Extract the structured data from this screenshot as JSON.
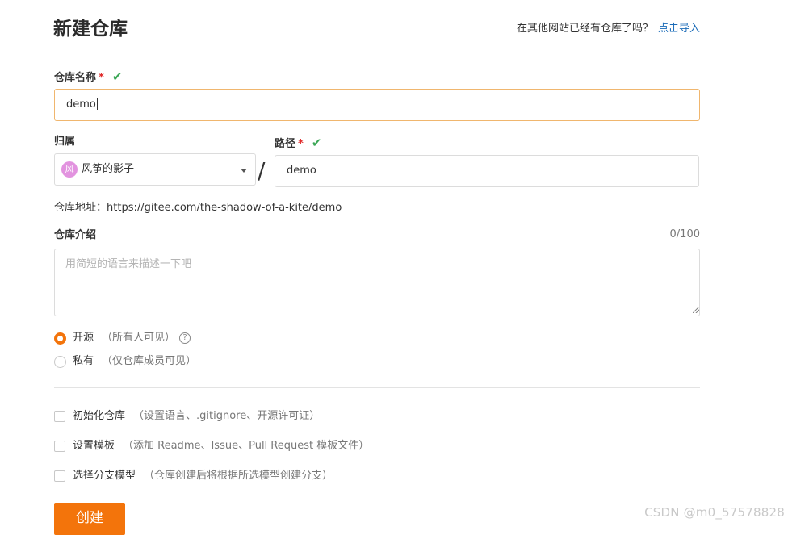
{
  "header": {
    "title": "新建仓库",
    "import_prompt": "在其他网站已经有仓库了吗？",
    "import_link": "点击导入"
  },
  "repo_name": {
    "label": "仓库名称",
    "required_mark": "*",
    "valid_icon": "check-icon",
    "value": "demo"
  },
  "owner": {
    "label": "归属",
    "avatar_char": "风",
    "value": "风筝的影子"
  },
  "separator": "/",
  "path": {
    "label": "路径",
    "required_mark": "*",
    "valid_icon": "check-icon",
    "value": "demo"
  },
  "address": {
    "label": "仓库地址：",
    "url": "https://gitee.com/the-shadow-of-a-kite/demo"
  },
  "intro": {
    "label": "仓库介绍",
    "counter": "0/100",
    "placeholder": "用简短的语言来描述一下吧"
  },
  "visibility": {
    "options": [
      {
        "label": "开源",
        "hint": "（所有人可见）",
        "selected": true,
        "help": "?"
      },
      {
        "label": "私有",
        "hint": "（仅仓库成员可见）",
        "selected": false
      }
    ]
  },
  "init_options": [
    {
      "label": "初始化仓库",
      "hint": "（设置语言、.gitignore、开源许可证）",
      "checked": false
    },
    {
      "label": "设置模板",
      "hint": "（添加 Readme、Issue、Pull Request 模板文件）",
      "checked": false
    },
    {
      "label": "选择分支模型",
      "hint": "（仓库创建后将根据所选模型创建分支）",
      "checked": false
    }
  ],
  "create_button": "创建",
  "watermark": "CSDN @m0_57578828",
  "colors": {
    "accent": "#f3740b",
    "link": "#1a6bb8",
    "valid": "#3aa655",
    "required": "#e02a2a",
    "focus_border": "#f0b66e"
  }
}
